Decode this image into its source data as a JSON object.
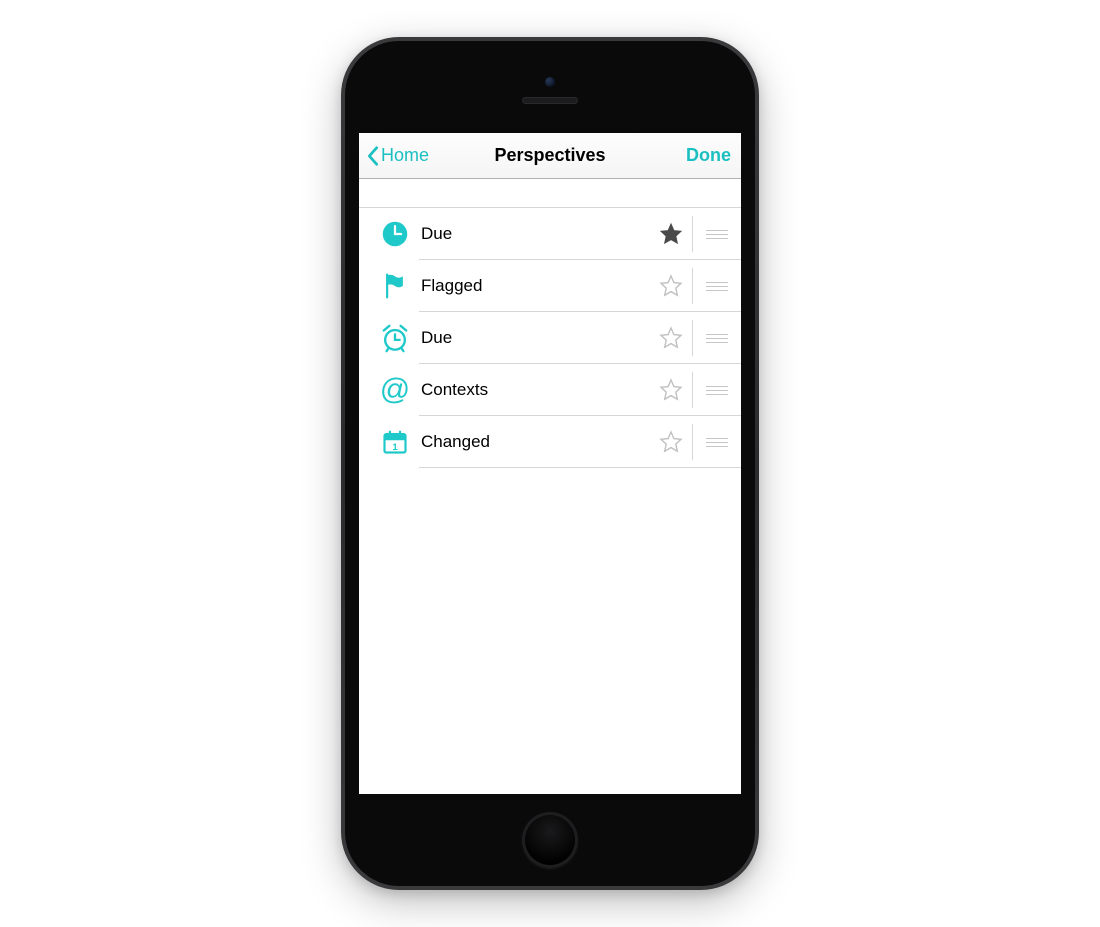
{
  "colors": {
    "accent": "#1abfc1",
    "iconAccent": "#1fc9ca",
    "starFilled": "#4a4a4a",
    "starEmpty": "#c0c0c0"
  },
  "nav": {
    "back_label": "Home",
    "title": "Perspectives",
    "done_label": "Done"
  },
  "rows": [
    {
      "icon": "clock",
      "label": "Due",
      "starred": true
    },
    {
      "icon": "flag",
      "label": "Flagged",
      "starred": false
    },
    {
      "icon": "alarm",
      "label": "Due",
      "starred": false
    },
    {
      "icon": "at",
      "label": "Contexts",
      "starred": false
    },
    {
      "icon": "calendar",
      "label": "Changed",
      "starred": false
    }
  ]
}
